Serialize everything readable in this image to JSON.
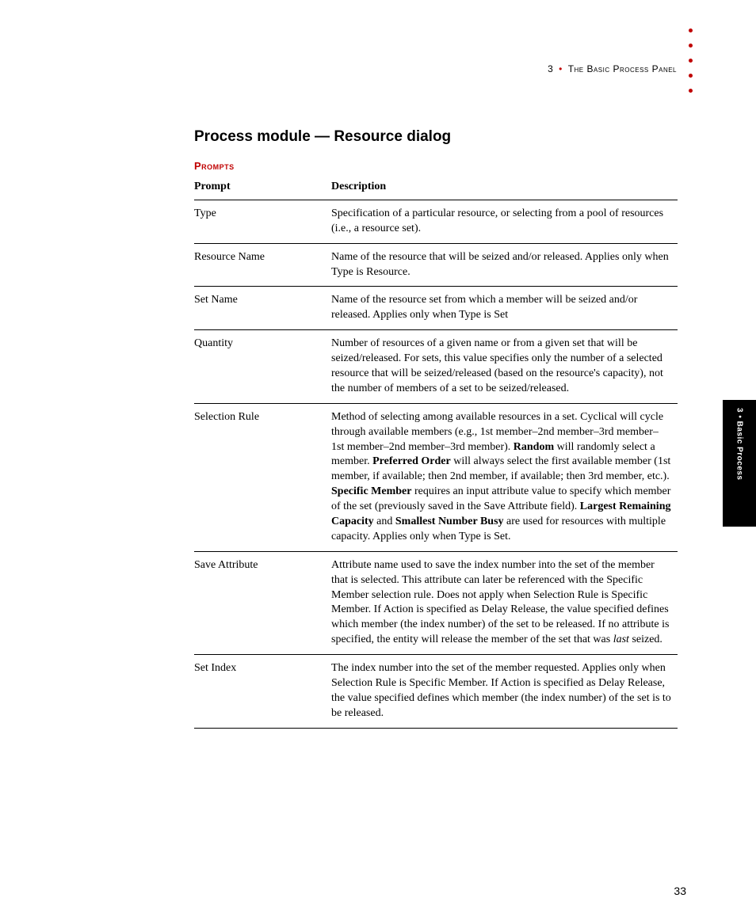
{
  "header": {
    "chapter_number": "3",
    "separator": "•",
    "chapter_title": "The Basic Process Panel"
  },
  "section_title": "Process module — Resource dialog",
  "subhead": "Prompts",
  "table": {
    "col_prompt": "Prompt",
    "col_desc": "Description",
    "rows": [
      {
        "prompt": "Type",
        "desc_html": "Specification of a particular resource, or selecting from a pool of resources (i.e., a resource set)."
      },
      {
        "prompt": "Resource Name",
        "desc_html": "Name of the resource that will be seized and/or released. Applies only when Type is Resource."
      },
      {
        "prompt": "Set Name",
        "desc_html": "Name of the resource set from which a member will be seized and/or released. Applies only when Type is Set"
      },
      {
        "prompt": "Quantity",
        "desc_html": "Number of resources of a given name or from a given set that will be seized/released. For sets, this value specifies only the number of a selected resource that will be seized/released (based on the resource's capacity), not the number of members of a set to be seized/released."
      },
      {
        "prompt": "Selection Rule",
        "desc_html": "Method of selecting among available resources in a set. Cyclical will cycle through available members (e.g., 1st member–2nd member–3rd member–1st member–2nd member–3rd member). <b>Random</b> will randomly select a member. <b>Preferred Order</b> will always select the first available member (1st member, if available; then 2nd member, if available; then 3rd member, etc.). <b>Specific Member</b> requires an input attribute value to specify which member of the set (previously saved in the Save Attribute field). <b>Largest Remaining Capacity</b> and <b>Smallest Number Busy</b> are used for resources with multiple capacity. Applies only when Type is Set."
      },
      {
        "prompt": "Save Attribute",
        "desc_html": "Attribute name used to save the index number into the set of the member that is selected. This attribute can later be referenced with the Specific Member selection rule. Does not apply when Selection Rule is Specific Member. If Action is specified as Delay Release, the value specified defines which member (the index number) of the set to be released. If no attribute is specified, the entity will release the member of the set that was <i>last</i> seized."
      },
      {
        "prompt": "Set Index",
        "desc_html": "The index number into the set of the member requested. Applies only when Selection Rule is Specific Member. If Action is specified as Delay Release, the value specified defines which member (the index number) of the set is to be released."
      }
    ]
  },
  "sidetab": "3 • Basic Process",
  "page_number": "33"
}
